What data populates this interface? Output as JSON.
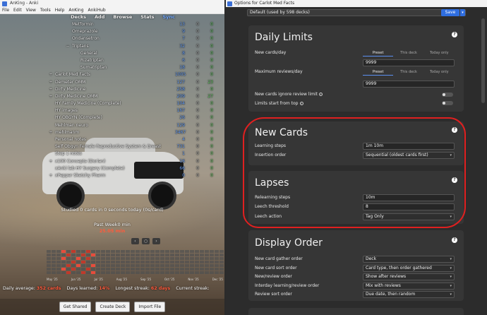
{
  "anki": {
    "window_title": "AnKing - Anki",
    "menu": [
      "File",
      "Edit",
      "View",
      "Tools",
      "Help",
      "AnKing",
      "AnkiHub"
    ],
    "toolbar": [
      "Decks",
      "Add",
      "Browse",
      "Stats",
      "Sync"
    ],
    "decks": [
      {
        "indent": 2,
        "exp": "",
        "name": "Metformin",
        "n1": "13",
        "n2": "0",
        "n3": "0"
      },
      {
        "indent": 2,
        "exp": "",
        "name": "Omeprazole",
        "n1": "9",
        "n2": "0",
        "n3": "0"
      },
      {
        "indent": 2,
        "exp": "",
        "name": "Ondansetron",
        "n1": "7",
        "n2": "0",
        "n3": "0"
      },
      {
        "indent": 2,
        "exp": "−",
        "name": "Triptans",
        "n1": "32",
        "n2": "0",
        "n3": "0"
      },
      {
        "indent": 3,
        "exp": "",
        "name": "General",
        "n1": "8",
        "n2": "0",
        "n3": "0"
      },
      {
        "indent": 3,
        "exp": "",
        "name": "Rizatriptan",
        "n1": "6",
        "n2": "0",
        "n3": "0"
      },
      {
        "indent": 3,
        "exp": "",
        "name": "Sumatriptan",
        "n1": "18",
        "n2": "0",
        "n3": "0"
      },
      {
        "indent": 0,
        "exp": "+",
        "name": "Carlot Med Facts",
        "n1": "1005",
        "n2": "0",
        "n3": "0"
      },
      {
        "indent": 0,
        "exp": "+",
        "name": "Demeter OMM",
        "n1": "127",
        "n2": "0",
        "n3": "23"
      },
      {
        "indent": 0,
        "exp": "+",
        "name": "Dirty Medicine",
        "n1": "258",
        "n2": "0",
        "n3": "0"
      },
      {
        "indent": 0,
        "exp": "+",
        "name": "Dirty Medicine OMM",
        "n1": "209",
        "n2": "0",
        "n3": "27"
      },
      {
        "indent": 0,
        "exp": "",
        "name": "HY Family Medicine (Complete)",
        "n1": "104",
        "n2": "0",
        "n3": "0"
      },
      {
        "indent": 0,
        "exp": "",
        "name": "HY images",
        "n1": "167",
        "n2": "0",
        "n3": "0"
      },
      {
        "indent": 0,
        "exp": "",
        "name": "HY OBGYN (Complete)",
        "n1": "26",
        "n2": "0",
        "n3": "0"
      },
      {
        "indent": 0,
        "exp": "",
        "name": "Mehlman neuro",
        "n1": "129",
        "n2": "0",
        "n3": "0"
      },
      {
        "indent": 0,
        "exp": "+",
        "name": "mehlmanm",
        "n1": "3467",
        "n2": "0",
        "n3": "0"
      },
      {
        "indent": 0,
        "exp": "",
        "name": "Personal notes",
        "n1": "4",
        "n2": "0",
        "n3": "0"
      },
      {
        "indent": 0,
        "exp": "",
        "name": "Self Obgyn Female Reproductive System & Breast",
        "n1": "731",
        "n2": "0",
        "n3": "0"
      },
      {
        "indent": 0,
        "exp": "",
        "name": "Step 1 notes",
        "n1": "1",
        "n2": "0",
        "n3": "0"
      },
      {
        "indent": 0,
        "exp": "+",
        "name": "x100 Concepts (Dorian)",
        "n1": "16",
        "n2": "0",
        "n3": "0"
      },
      {
        "indent": 0,
        "exp": "",
        "name": "xAnki lab HY Surgery (Complete)",
        "n1": "66",
        "n2": "0",
        "n3": "0"
      },
      {
        "indent": 0,
        "exp": "+",
        "name": "xPepper Sketchy Pharm",
        "n1": "0",
        "n2": "0",
        "n3": "0"
      }
    ],
    "studied": "Studied 0 cards in 0 seconds today (0s/card)",
    "past_week": "Past Week0 min",
    "past_week_min": "25.05 min",
    "heatmap_nav": [
      "‹",
      "○",
      "›"
    ],
    "heatmap_months": [
      "May '25",
      "Jun '25",
      "Jul '25",
      "Aug '25",
      "Sep '25",
      "Oct '25",
      "Nov '25",
      "Dec '25"
    ],
    "stats": {
      "daily_avg_label": "Daily average:",
      "daily_avg": "352 cards",
      "days_learned_label": "Days learned:",
      "days_learned": "14%",
      "longest_label": "Longest streak:",
      "longest": "62 days",
      "current_label": "Current streak:"
    },
    "bottom_buttons": [
      "Get Shared",
      "Create Deck",
      "Import File"
    ]
  },
  "options": {
    "window_title": "Options for Carlot Med Facts",
    "preset": "Default (used by 598 decks)",
    "save": "Save",
    "daily_limits": {
      "title": "Daily Limits",
      "new_cards_label": "New cards/day",
      "tabs": [
        "Preset",
        "This deck",
        "Today only"
      ],
      "new_cards_value": "9999",
      "max_reviews_label": "Maximum reviews/day",
      "max_reviews_value": "9999",
      "ignore_label": "New cards ignore review limit",
      "limits_top_label": "Limits start from top"
    },
    "new_cards": {
      "title": "New Cards",
      "learning_steps_label": "Learning steps",
      "learning_steps": "1m 10m",
      "insertion_label": "Insertion order",
      "insertion": "Sequential (oldest cards first)"
    },
    "lapses": {
      "title": "Lapses",
      "relearning_label": "Relearning steps",
      "relearning": "10m",
      "leech_threshold_label": "Leech threshold",
      "leech_threshold": "8",
      "leech_action_label": "Leech action",
      "leech_action": "Tag Only"
    },
    "display_order": {
      "title": "Display Order",
      "rows": [
        {
          "label": "New card gather order",
          "value": "Deck"
        },
        {
          "label": "New card sort order",
          "value": "Card type, then order gathered"
        },
        {
          "label": "New/review order",
          "value": "Show after reviews"
        },
        {
          "label": "Interday learning/review order",
          "value": "Mix with reviews"
        },
        {
          "label": "Review sort order",
          "value": "Due date, then random"
        }
      ]
    }
  },
  "colors": {
    "accent": "#2f6ee0",
    "highlight": "#e02020",
    "due": "#6bd36b",
    "new": "#6fa7ff"
  }
}
